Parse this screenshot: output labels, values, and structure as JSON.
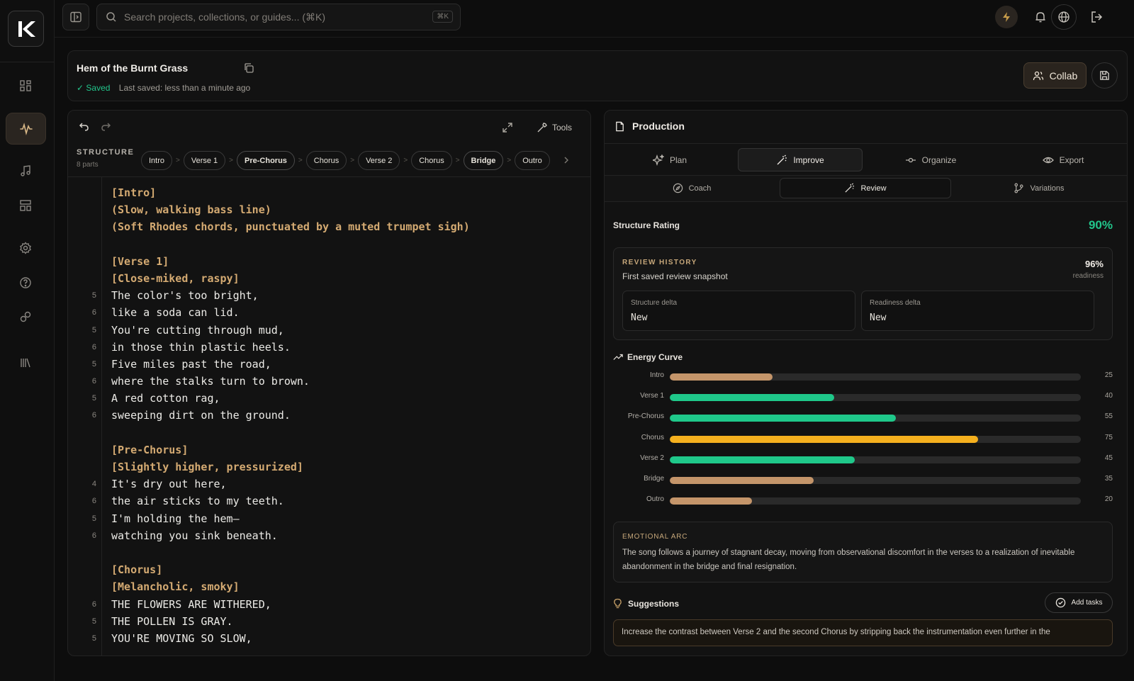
{
  "app": {
    "logo_text": "K"
  },
  "search": {
    "placeholder": "Search projects, collections, or guides... (⌘K)",
    "shortcut": "⌘K"
  },
  "sidebar": {
    "items": [
      {
        "icon": "dashboard-icon"
      },
      {
        "icon": "waveform-icon",
        "active": true
      },
      {
        "icon": "music-note-icon"
      },
      {
        "icon": "layout-icon"
      },
      {
        "icon": "gear-icon"
      },
      {
        "icon": "help-icon"
      },
      {
        "icon": "link-icon"
      },
      {
        "icon": "library-icon"
      }
    ]
  },
  "project": {
    "title": "Hem of the Burnt Grass",
    "saved_label": "Saved",
    "last_saved": "Last saved: less than a minute ago",
    "collab_label": "Collab"
  },
  "editor": {
    "tools_label": "Tools",
    "structure_label": "STRUCTURE",
    "structure_count": "8 parts",
    "sections": [
      "Intro",
      "Verse 1",
      "Pre-Chorus",
      "Chorus",
      "Verse 2",
      "Chorus",
      "Bridge",
      "Outro"
    ],
    "lines": [
      {
        "num": "",
        "text": "[Intro]",
        "tag": true
      },
      {
        "num": "",
        "text": "(Slow, walking bass line)",
        "tag": true
      },
      {
        "num": "",
        "text": "(Soft Rhodes chords, punctuated by a muted trumpet sigh)",
        "tag": true
      },
      {
        "num": "",
        "text": "",
        "tag": false
      },
      {
        "num": "",
        "text": "[Verse 1]",
        "tag": true
      },
      {
        "num": "",
        "text": "[Close-miked, raspy]",
        "tag": true
      },
      {
        "num": "5",
        "text": "The color's too bright,",
        "tag": false
      },
      {
        "num": "6",
        "text": "like a soda can lid.",
        "tag": false
      },
      {
        "num": "5",
        "text": "You're cutting through mud,",
        "tag": false
      },
      {
        "num": "6",
        "text": "in those thin plastic heels.",
        "tag": false
      },
      {
        "num": "5",
        "text": "Five miles past the road,",
        "tag": false
      },
      {
        "num": "6",
        "text": "where the stalks turn to brown.",
        "tag": false
      },
      {
        "num": "5",
        "text": "A red cotton rag,",
        "tag": false
      },
      {
        "num": "6",
        "text": "sweeping dirt on the ground.",
        "tag": false
      },
      {
        "num": "",
        "text": "",
        "tag": false
      },
      {
        "num": "",
        "text": "[Pre-Chorus]",
        "tag": true
      },
      {
        "num": "",
        "text": "[Slightly higher, pressurized]",
        "tag": true
      },
      {
        "num": "4",
        "text": "It's dry out here,",
        "tag": false
      },
      {
        "num": "6",
        "text": "the air sticks to my teeth.",
        "tag": false
      },
      {
        "num": "5",
        "text": "I'm holding the hem—",
        "tag": false
      },
      {
        "num": "6",
        "text": "watching you sink beneath.",
        "tag": false
      },
      {
        "num": "",
        "text": "",
        "tag": false
      },
      {
        "num": "",
        "text": "[Chorus]",
        "tag": true
      },
      {
        "num": "",
        "text": "[Melancholic, smoky]",
        "tag": true
      },
      {
        "num": "6",
        "text": "THE FLOWERS ARE WITHERED,",
        "tag": false
      },
      {
        "num": "5",
        "text": "THE POLLEN IS GRAY.",
        "tag": false
      },
      {
        "num": "5",
        "text": "YOU'RE MOVING SO SLOW,",
        "tag": false
      }
    ]
  },
  "production": {
    "title": "Production",
    "tabs": [
      "Plan",
      "Improve",
      "Organize",
      "Export"
    ],
    "active_tab": "Improve",
    "subtabs": [
      "Coach",
      "Review",
      "Variations"
    ],
    "active_subtab": "Review",
    "structure_rating_label": "Structure Rating",
    "structure_rating_value": "90%",
    "review_history": {
      "title": "REVIEW HISTORY",
      "subtitle": "First saved review snapshot",
      "value": "96%",
      "unit": "readiness",
      "structure_delta_label": "Structure delta",
      "structure_delta_value": "New",
      "readiness_delta_label": "Readiness delta",
      "readiness_delta_value": "New"
    },
    "energy_title": "Energy Curve",
    "energy": [
      {
        "label": "Intro",
        "value": 25,
        "color": "#c4956a"
      },
      {
        "label": "Verse 1",
        "value": 40,
        "color": "#1fc88a"
      },
      {
        "label": "Pre-Chorus",
        "value": 55,
        "color": "#1fc88a"
      },
      {
        "label": "Chorus",
        "value": 75,
        "color": "#f5b01e"
      },
      {
        "label": "Verse 2",
        "value": 45,
        "color": "#1fc88a"
      },
      {
        "label": "Bridge",
        "value": 35,
        "color": "#c4956a"
      },
      {
        "label": "Outro",
        "value": 20,
        "color": "#c4956a"
      }
    ],
    "emotional_arc_title": "EMOTIONAL ARC",
    "emotional_arc_text": "The song follows a journey of stagnant decay, moving from observational discomfort in the verses to a realization of inevitable abandonment in the bridge and final resignation.",
    "suggestions_title": "Suggestions",
    "add_tasks_label": "Add tasks",
    "suggestion_text": "Increase the contrast between Verse 2 and the second Chorus by stripping back the instrumentation even further in the"
  }
}
